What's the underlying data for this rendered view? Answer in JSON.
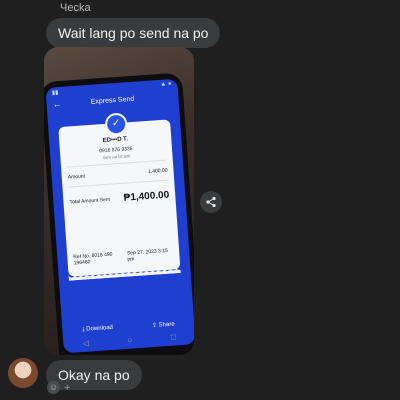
{
  "chat": {
    "sender_name": "Чecka",
    "messages": [
      {
        "text": "Wait lang po send na po"
      },
      {
        "text": "Okay na po"
      }
    ]
  },
  "receipt": {
    "screen_title": "Express Send",
    "recipient_name": "ED•••D T.",
    "recipient_number": "0916 876 9336",
    "sent_via": "Sent via GCash",
    "amount_label": "Amount",
    "amount_value": "1,400.00",
    "total_label": "Total Amount Sent",
    "total_value": "₱1,400.00",
    "ref_label": "Ref No. 8016 490 196460",
    "date_text": "Sep 27, 2023 3:15 pm",
    "download_label": "Download",
    "share_label": "Share"
  },
  "icons": {
    "share": "share-icon",
    "emoji": "emoji-icon",
    "add": "plus-icon",
    "check": "check-icon"
  },
  "colors": {
    "background": "#1f1f1f",
    "bubble": "#3a3b3c",
    "app_blue": "#1f3fd1"
  }
}
